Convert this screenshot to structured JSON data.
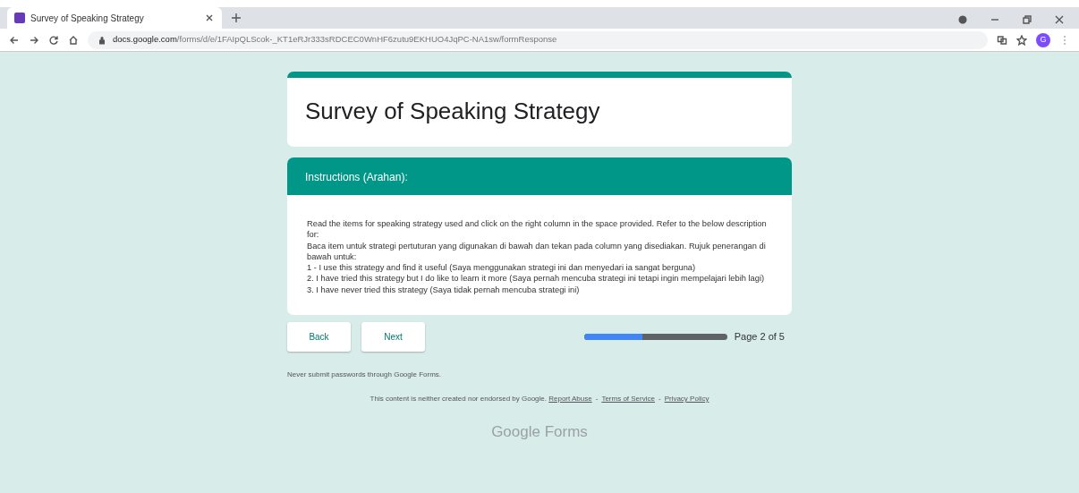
{
  "browser": {
    "tab": {
      "title": "Survey of Speaking Strategy",
      "selected": true
    },
    "url_host": "docs.google.com",
    "url_path": "/forms/d/e/1FAIpQLScok-_KT1eRJr333sRDCEC0WnHF6zutu9EKHUO4JqPC-NA1sw/formResponse",
    "profile_initial": "G"
  },
  "form": {
    "title": "Survey of Speaking Strategy",
    "section": {
      "title": "Instructions (Arahan):",
      "lines": [
        "Read the items for speaking strategy used and click on the right column in the space provided. Refer to the below description for:",
        "Baca item untuk strategi pertuturan yang digunakan di bawah dan tekan pada column yang disediakan. Rujuk penerangan di bawah untuk:",
        "1 - I use this strategy and find it useful (Saya menggunakan strategi ini dan menyedari ia sangat berguna)",
        "2. I have tried this strategy but I do like to learn it more (Saya pernah mencuba strategi ini tetapi ingin mempelajari lebih lagi)",
        "3. I have never tried this strategy (Saya tidak pernah mencuba strategi ini)"
      ]
    },
    "buttons": [
      "Back",
      "Next"
    ],
    "progress": {
      "level": 0.41,
      "label": "Page 2 of 5"
    },
    "warning": "Never submit passwords through Google Forms.",
    "footer": {
      "text": "This content is neither created nor endorsed by Google.",
      "links": [
        "Report Abuse",
        "Terms of Service",
        "Privacy Policy"
      ],
      "separator": "-"
    },
    "logo": {
      "google": "Google",
      "product": "Forms"
    }
  }
}
